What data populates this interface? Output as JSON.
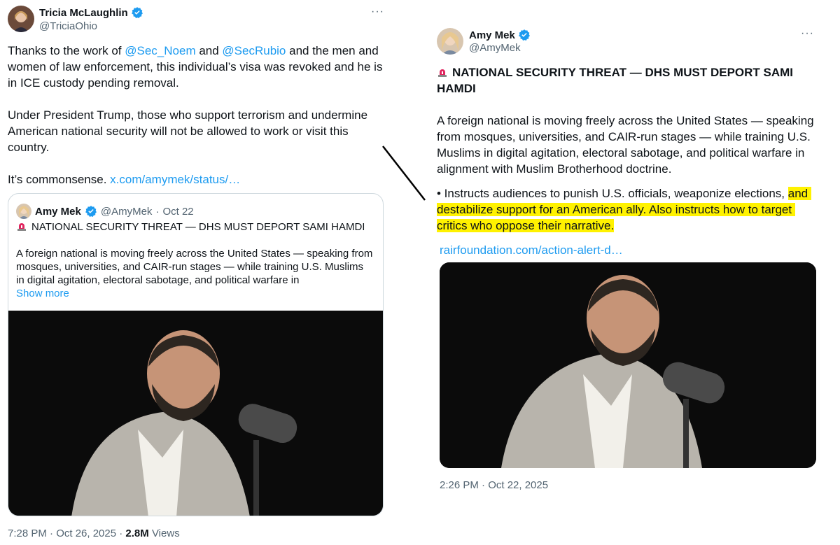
{
  "left_tweet": {
    "author_name": "Tricia McLaughlin",
    "author_handle": "@TriciaOhio",
    "more_label": "···",
    "para1": {
      "t1": "Thanks to the work of ",
      "mention1": "@Sec_Noem",
      "t2": " and ",
      "mention2": "@SecRubio",
      "t3": " and the men and women of law enforcement, this individual’s visa was revoked and he is in ICE custody pending removal."
    },
    "para2": "Under President Trump, those who support terrorism and undermine American national security will not be allowed to work or visit this country.",
    "para3_text": "It’s commonsense. ",
    "para3_link": "x.com/amymek/status/…",
    "quote": {
      "author_name": "Amy Mek",
      "author_handle": "@AmyMek",
      "separator": "·",
      "date": "Oct 22",
      "headline": "NATIONAL SECURITY THREAT — DHS MUST DEPORT SAMI HAMDI",
      "text": "A foreign national is moving freely across the United States — speaking from mosques, universities, and CAIR-run stages — while training U.S. Muslims in digital agitation, electoral sabotage, and political warfare in",
      "show_more": "Show more"
    },
    "timestamp": "7:28 PM · Oct 26, 2025 · ",
    "views_count": "2.8M",
    "views_label": " Views"
  },
  "right_tweet": {
    "author_name": "Amy Mek",
    "author_handle": "@AmyMek",
    "more_label": "···",
    "headline": "NATIONAL SECURITY THREAT — DHS MUST DEPORT SAMI HAMDI",
    "para1": "A foreign national is moving freely across the United States — speaking from mosques, universities, and CAIR-run stages — while training U.S. Muslims in digital agitation, electoral sabotage, and political warfare in alignment with Muslim Brotherhood doctrine.",
    "bullet_plain": "• Instructs audiences to punish U.S. officials, weaponize elections, ",
    "bullet_highlight": "and destabilize support for an American ally. Also instructs how to target critics who oppose their narrative.",
    "link": "rairfoundation.com/action-alert-d…",
    "timestamp": "2:26 PM · Oct 22, 2025"
  },
  "colors": {
    "link": "#1d9bf0",
    "verified": "#1d9bf0",
    "highlight": "#fff200",
    "muted": "#536471"
  },
  "icons": [
    "verified-badge-icon",
    "siren-emoji-icon",
    "more-options-icon"
  ]
}
